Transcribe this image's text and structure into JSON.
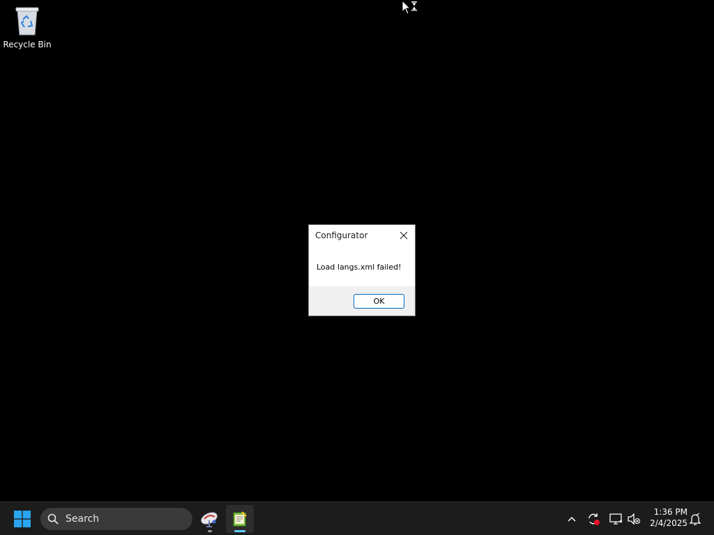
{
  "desktop": {
    "icons": [
      {
        "label": "Recycle Bin",
        "icon": "recycle-bin-icon"
      }
    ]
  },
  "dialog": {
    "title": "Configurator",
    "message": "Load langs.xml failed!",
    "ok_label": "OK",
    "close_icon": "close-icon"
  },
  "taskbar": {
    "start_icon": "windows-start-icon",
    "search_placeholder": "Search",
    "apps": [
      {
        "name": "configurator-app",
        "icon": "satellite-dish-icon",
        "active": false
      },
      {
        "name": "notepad-app",
        "icon": "notepad-icon",
        "active": true
      }
    ],
    "tray": [
      {
        "icon": "chevron-up-icon"
      },
      {
        "icon": "sync-alert-icon"
      },
      {
        "icon": "network-icon"
      },
      {
        "icon": "speaker-muted-icon"
      }
    ],
    "clock": {
      "time": "1:36 PM",
      "date": "2/4/2025"
    },
    "notification_icon": "notification-bell-icon"
  },
  "colors": {
    "desktop_bg": "#000000",
    "taskbar_bg": "#1c1c1c",
    "accent": "#0067c0",
    "start_blue": "#2aa5f0"
  }
}
